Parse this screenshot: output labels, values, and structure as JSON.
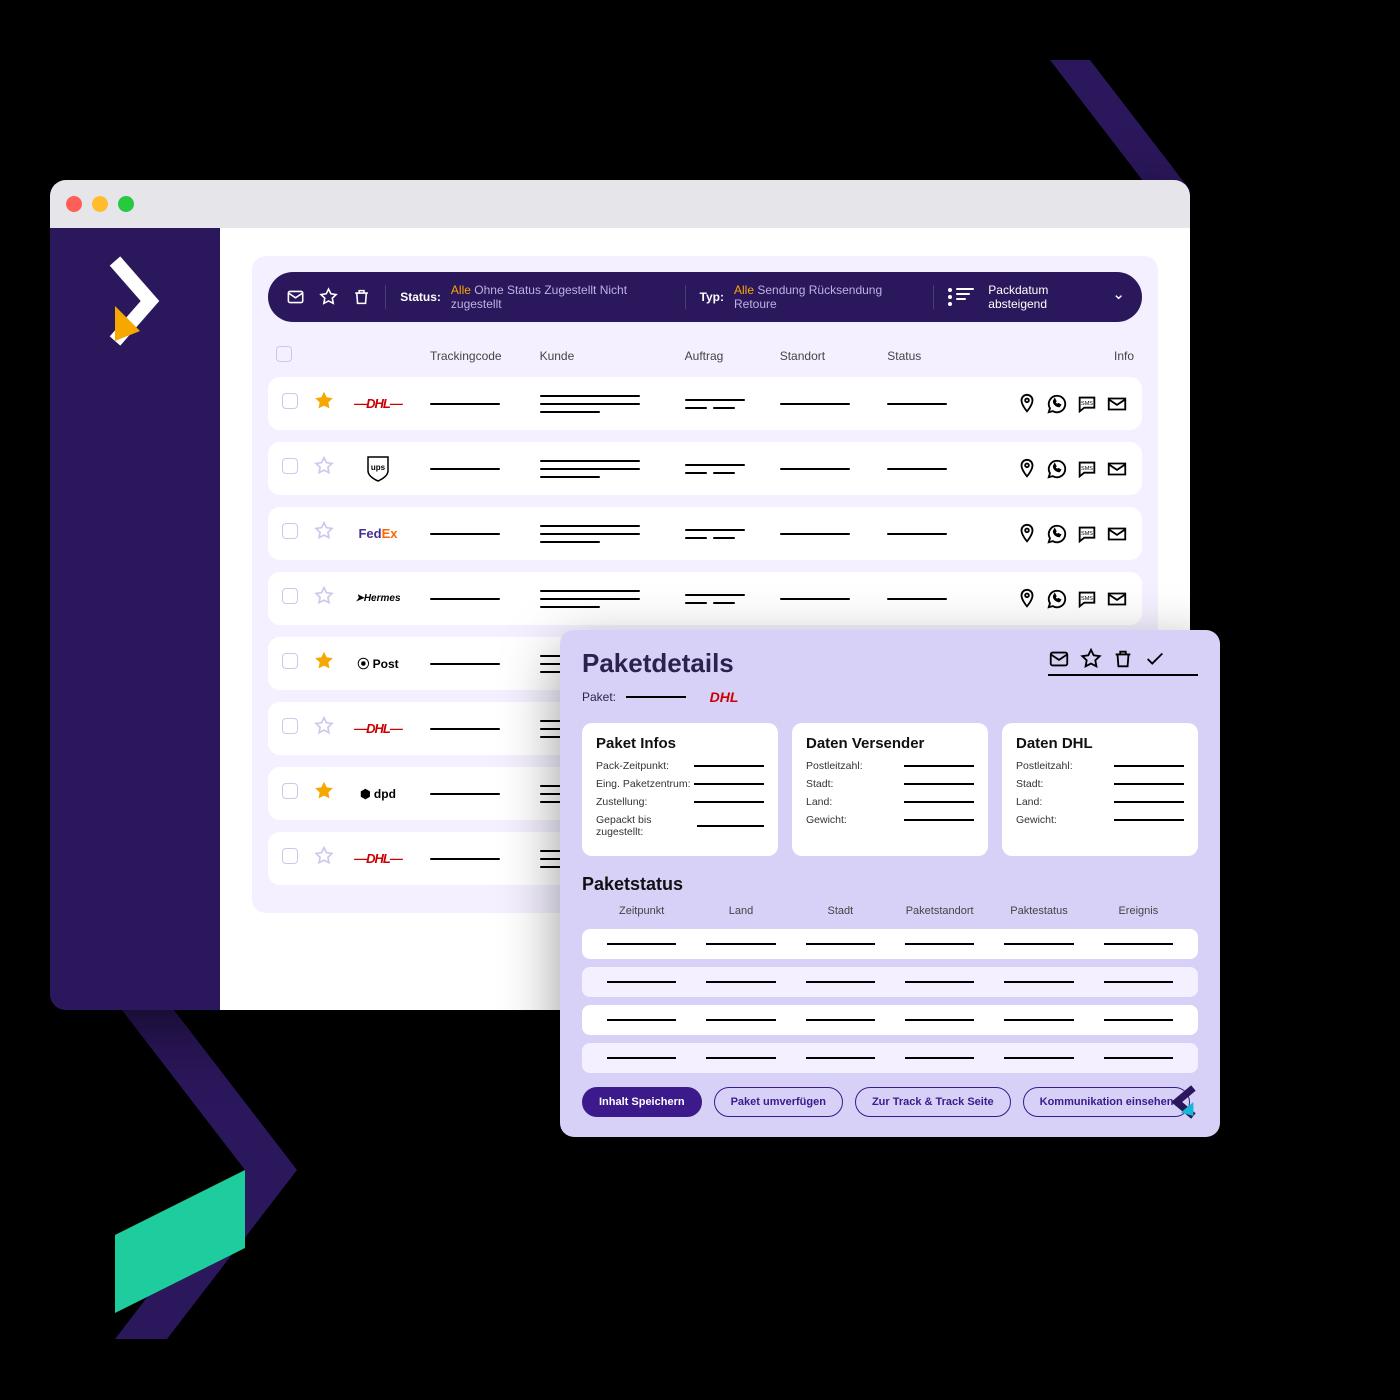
{
  "filter": {
    "status_label": "Status:",
    "status_options": [
      "Alle",
      "Ohne Status",
      "Zugestellt",
      "Nicht zugestellt"
    ],
    "status_active": 0,
    "type_label": "Typ:",
    "type_options": [
      "Alle",
      "Sendung",
      "Rücksendung",
      "Retoure"
    ],
    "type_active": 0,
    "sort_label": "Packdatum absteigend"
  },
  "columns": {
    "tracking": "Trackingcode",
    "customer": "Kunde",
    "order": "Auftrag",
    "location": "Standort",
    "status": "Status",
    "info": "Info"
  },
  "rows": [
    {
      "carrier": "DHL",
      "starred": true,
      "icons": [
        "pin",
        "whatsapp",
        "sms",
        "mail"
      ],
      "mood": "g"
    },
    {
      "carrier": "UPS",
      "starred": false,
      "icons": [
        "pin",
        "whatsapp",
        "sms",
        "mail"
      ],
      "mood": "p"
    },
    {
      "carrier": "FedEx",
      "starred": false,
      "icons": [
        "pin",
        "whatsapp",
        "sms",
        "mail"
      ],
      "mood": "g"
    },
    {
      "carrier": "Hermes",
      "starred": false,
      "icons": [
        "pin",
        "whatsapp",
        "sms",
        "mail"
      ],
      "mood": "k"
    },
    {
      "carrier": "Post",
      "starred": true,
      "icons": [],
      "mood": ""
    },
    {
      "carrier": "DHL",
      "starred": false,
      "icons": [],
      "mood": ""
    },
    {
      "carrier": "dpd",
      "starred": true,
      "icons": [],
      "mood": ""
    },
    {
      "carrier": "DHL",
      "starred": false,
      "icons": [],
      "mood": ""
    }
  ],
  "modal": {
    "title": "Paketdetails",
    "paket_label": "Paket:",
    "paket_carrier": "DHL",
    "card1": {
      "title": "Paket Infos",
      "keys": [
        "Pack-Zeitpunkt:",
        "Eing. Paketzentrum:",
        "Zustellung:",
        "Gepackt bis zugestellt:"
      ]
    },
    "card2": {
      "title": "Daten Versender",
      "keys": [
        "Postleitzahl:",
        "Stadt:",
        "Land:",
        "Gewicht:"
      ]
    },
    "card3": {
      "title": "Daten DHL",
      "keys": [
        "Postleitzahl:",
        "Stadt:",
        "Land:",
        "Gewicht:"
      ]
    },
    "status_title": "Paketstatus",
    "status_cols": [
      "Zeitpunkt",
      "Land",
      "Stadt",
      "Paketstandort",
      "Paktestatus",
      "Ereignis"
    ],
    "status_row_count": 4,
    "buttons": {
      "save": "Inhalt Speichern",
      "move": "Paket umverfügen",
      "track": "Zur Track & Track Seite",
      "comm": "Kommunikation einsehen"
    }
  }
}
